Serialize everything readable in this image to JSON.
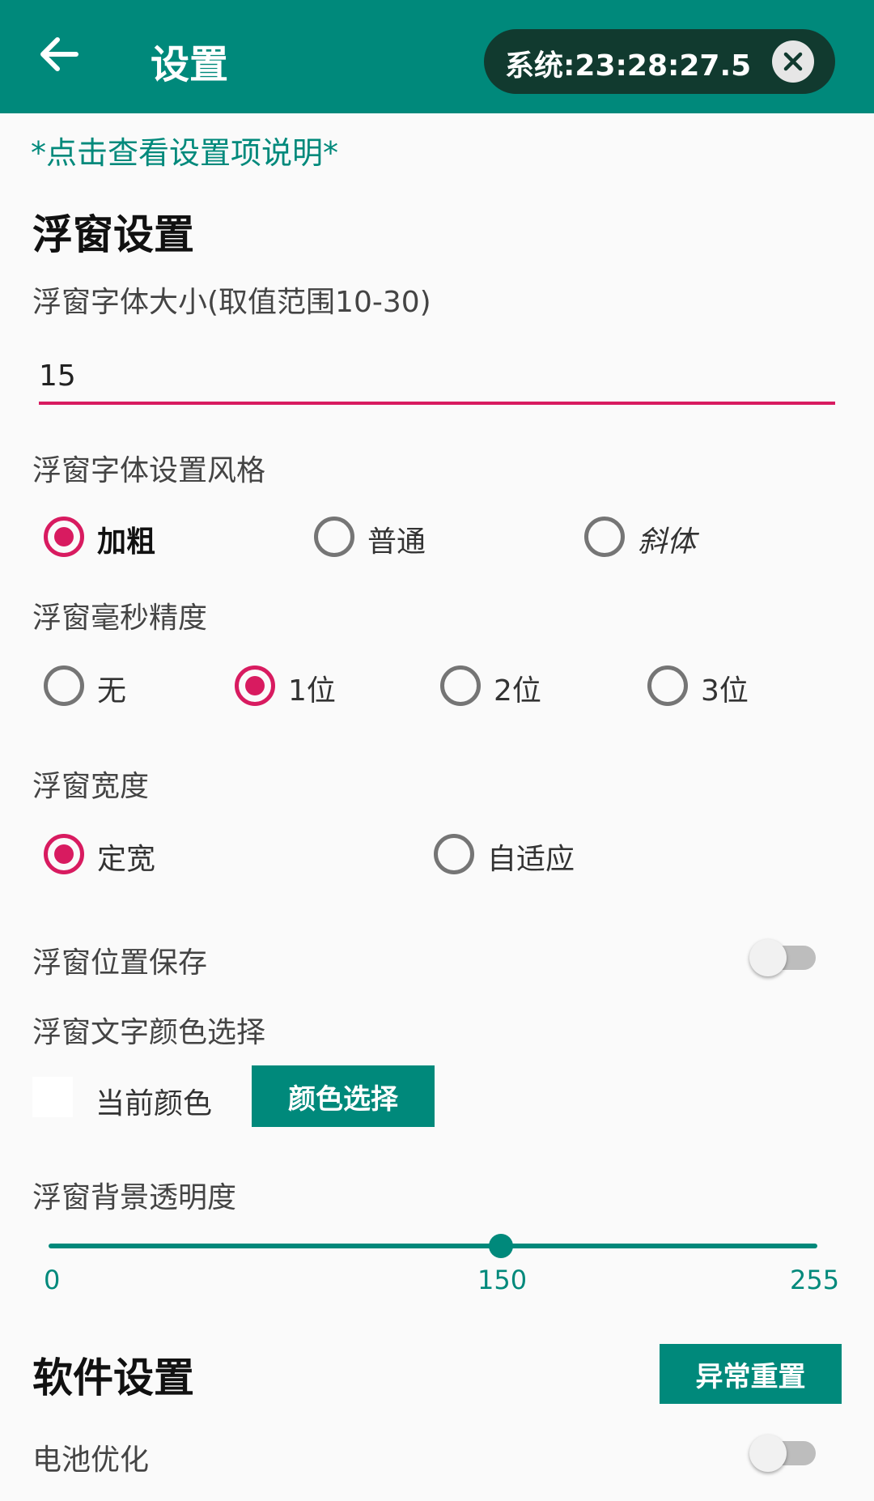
{
  "colors": {
    "accent": "#00897b",
    "selected": "#d81b60",
    "clock_bg": "#113a2f"
  },
  "appbar": {
    "back_icon": "arrow-left-icon",
    "title": "设置",
    "clock": "系统:23:28:27.5",
    "close_icon": "close-icon"
  },
  "hint": "*点击查看设置项说明*",
  "float_section": {
    "title": "浮窗设置",
    "font_size": {
      "label": "浮窗字体大小(取值范围10-30)",
      "value": "15"
    },
    "font_style": {
      "label": "浮窗字体设置风格",
      "options": [
        "加粗",
        "普通",
        "斜体"
      ],
      "selected": "加粗"
    },
    "ms_precision": {
      "label": "浮窗毫秒精度",
      "options": [
        "无",
        "1位",
        "2位",
        "3位"
      ],
      "selected": "1位"
    },
    "width": {
      "label": "浮窗宽度",
      "options": [
        "定宽",
        "自适应"
      ],
      "selected": "定宽"
    },
    "position_save": {
      "label": "浮窗位置保存",
      "checked": false
    },
    "text_color": {
      "label": "浮窗文字颜色选择",
      "current_label": "当前颜色",
      "current_color": "#ffffff",
      "button": "颜色选择"
    },
    "bg_alpha": {
      "label": "浮窗背景透明度",
      "min": "0",
      "value": "150",
      "max": "255"
    }
  },
  "software_section": {
    "title": "软件设置",
    "reset_button": "异常重置",
    "battery": {
      "label": "电池优化",
      "checked": false
    }
  }
}
